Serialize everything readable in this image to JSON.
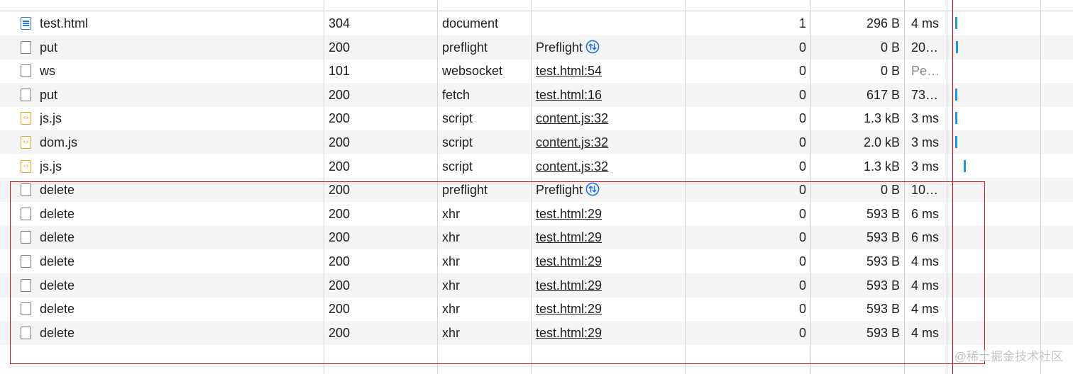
{
  "requests": [
    {
      "name": "test.html",
      "icon": "document-icon",
      "status": "304",
      "type": "document",
      "initiator": "",
      "initiator_link": false,
      "preflight": false,
      "cookies": "1",
      "size": "296 B",
      "time": "4 ms",
      "pending": false
    },
    {
      "name": "put",
      "icon": "file-icon",
      "status": "200",
      "type": "preflight",
      "initiator": "Preflight",
      "initiator_link": false,
      "preflight": true,
      "cookies": "0",
      "size": "0 B",
      "time": "20…",
      "pending": false
    },
    {
      "name": "ws",
      "icon": "file-icon",
      "status": "101",
      "type": "websocket",
      "initiator": "test.html:54",
      "initiator_link": true,
      "preflight": false,
      "cookies": "0",
      "size": "0 B",
      "time": "Pe…",
      "pending": true
    },
    {
      "name": "put",
      "icon": "file-icon",
      "status": "200",
      "type": "fetch",
      "initiator": "test.html:16",
      "initiator_link": true,
      "preflight": false,
      "cookies": "0",
      "size": "617 B",
      "time": "73…",
      "pending": false
    },
    {
      "name": "js.js",
      "icon": "script-icon",
      "status": "200",
      "type": "script",
      "initiator": "content.js:32",
      "initiator_link": true,
      "preflight": false,
      "cookies": "0",
      "size": "1.3 kB",
      "time": "3 ms",
      "pending": false
    },
    {
      "name": "dom.js",
      "icon": "script-icon",
      "status": "200",
      "type": "script",
      "initiator": "content.js:32",
      "initiator_link": true,
      "preflight": false,
      "cookies": "0",
      "size": "2.0 kB",
      "time": "3 ms",
      "pending": false
    },
    {
      "name": "js.js",
      "icon": "script-icon",
      "status": "200",
      "type": "script",
      "initiator": "content.js:32",
      "initiator_link": true,
      "preflight": false,
      "cookies": "0",
      "size": "1.3 kB",
      "time": "3 ms",
      "pending": false
    },
    {
      "name": "delete",
      "icon": "file-icon",
      "status": "200",
      "type": "preflight",
      "initiator": "Preflight",
      "initiator_link": false,
      "preflight": true,
      "cookies": "0",
      "size": "0 B",
      "time": "10…",
      "pending": false
    },
    {
      "name": "delete",
      "icon": "file-icon",
      "status": "200",
      "type": "xhr",
      "initiator": "test.html:29",
      "initiator_link": true,
      "preflight": false,
      "cookies": "0",
      "size": "593 B",
      "time": "6 ms",
      "pending": false
    },
    {
      "name": "delete",
      "icon": "file-icon",
      "status": "200",
      "type": "xhr",
      "initiator": "test.html:29",
      "initiator_link": true,
      "preflight": false,
      "cookies": "0",
      "size": "593 B",
      "time": "6 ms",
      "pending": false
    },
    {
      "name": "delete",
      "icon": "file-icon",
      "status": "200",
      "type": "xhr",
      "initiator": "test.html:29",
      "initiator_link": true,
      "preflight": false,
      "cookies": "0",
      "size": "593 B",
      "time": "4 ms",
      "pending": false
    },
    {
      "name": "delete",
      "icon": "file-icon",
      "status": "200",
      "type": "xhr",
      "initiator": "test.html:29",
      "initiator_link": true,
      "preflight": false,
      "cookies": "0",
      "size": "593 B",
      "time": "4 ms",
      "pending": false
    },
    {
      "name": "delete",
      "icon": "file-icon",
      "status": "200",
      "type": "xhr",
      "initiator": "test.html:29",
      "initiator_link": true,
      "preflight": false,
      "cookies": "0",
      "size": "593 B",
      "time": "4 ms",
      "pending": false
    },
    {
      "name": "delete",
      "icon": "file-icon",
      "status": "200",
      "type": "xhr",
      "initiator": "test.html:29",
      "initiator_link": true,
      "preflight": false,
      "cookies": "0",
      "size": "593 B",
      "time": "4 ms",
      "pending": false
    }
  ],
  "colors": {
    "waterfall_bar": "#1a9ae0",
    "waterfall_line": "#c9001a",
    "highlight_box": "#e0141e",
    "row_alt": "#f5f5f5",
    "preflight_icon": "#1a73e8"
  },
  "watermark": "@稀土掘金技术社区"
}
